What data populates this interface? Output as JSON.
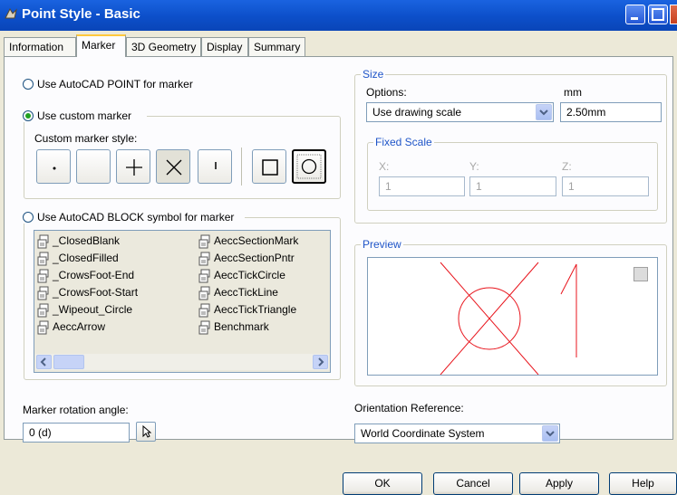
{
  "window": {
    "title": "Point Style - Basic"
  },
  "tabs": [
    "Information",
    "Marker",
    "3D Geometry",
    "Display",
    "Summary"
  ],
  "marker": {
    "option_autocad_point": "Use AutoCAD POINT for marker",
    "option_custom": "Use custom marker",
    "custom_style_label": "Custom marker style:",
    "option_block": "Use AutoCAD BLOCK symbol for marker",
    "selected_option": "custom",
    "block_list_col1": [
      "_ClosedBlank",
      "_ClosedFilled",
      "_CrowsFoot-End",
      "_CrowsFoot-Start",
      "_Wipeout_Circle",
      "AeccArrow"
    ],
    "block_list_col2": [
      "AeccSectionMark",
      "AeccSectionPntr",
      "AeccTickCircle",
      "AeccTickLine",
      "AeccTickTriangle",
      "Benchmark"
    ],
    "rotation_label": "Marker rotation angle:",
    "rotation_value": "0 (d)"
  },
  "size": {
    "legend": "Size",
    "options_label": "Options:",
    "units_label": "mm",
    "options_value": "Use drawing scale",
    "mm_value": "2.50mm",
    "fixed_scale_legend": "Fixed Scale",
    "x_label": "X:",
    "y_label": "Y:",
    "z_label": "Z:",
    "x_value": "1",
    "y_value": "1",
    "z_value": "1"
  },
  "preview": {
    "legend": "Preview",
    "stroke_color": "#e8141c"
  },
  "orientation": {
    "label": "Orientation Reference:",
    "value": "World Coordinate System"
  },
  "buttons": {
    "ok": "OK",
    "cancel": "Cancel",
    "apply": "Apply",
    "help": "Help"
  }
}
